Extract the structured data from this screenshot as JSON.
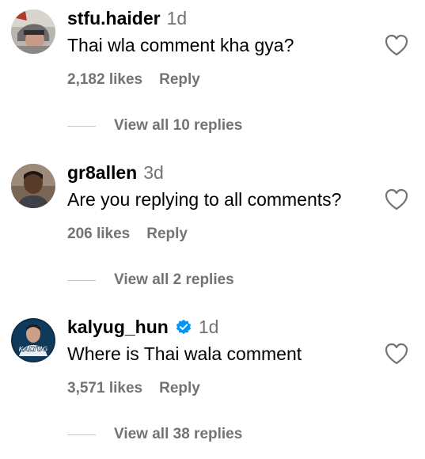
{
  "comments": [
    {
      "username": "stfu.haider",
      "time": "1d",
      "text": "Thai wla comment kha gya?",
      "likes": "2,182 likes",
      "reply_label": "Reply",
      "view_replies": "View all 10 replies",
      "verified": false
    },
    {
      "username": "gr8allen",
      "time": "3d",
      "text": "Are you replying to all comments?",
      "likes": "206 likes",
      "reply_label": "Reply",
      "view_replies": "View all 2 replies",
      "verified": false
    },
    {
      "username": "kalyug_hun",
      "time": "1d",
      "text": "Where is Thai wala comment",
      "likes": "3,571 likes",
      "reply_label": "Reply",
      "view_replies": "View all 38 replies",
      "verified": true,
      "avatar_text": "KALYUG"
    }
  ],
  "colors": {
    "secondary_text": "#737373",
    "verified_blue": "#0095f6",
    "divider": "#c7c7c7"
  },
  "icons": [
    "heart-icon",
    "verified-badge-icon"
  ]
}
